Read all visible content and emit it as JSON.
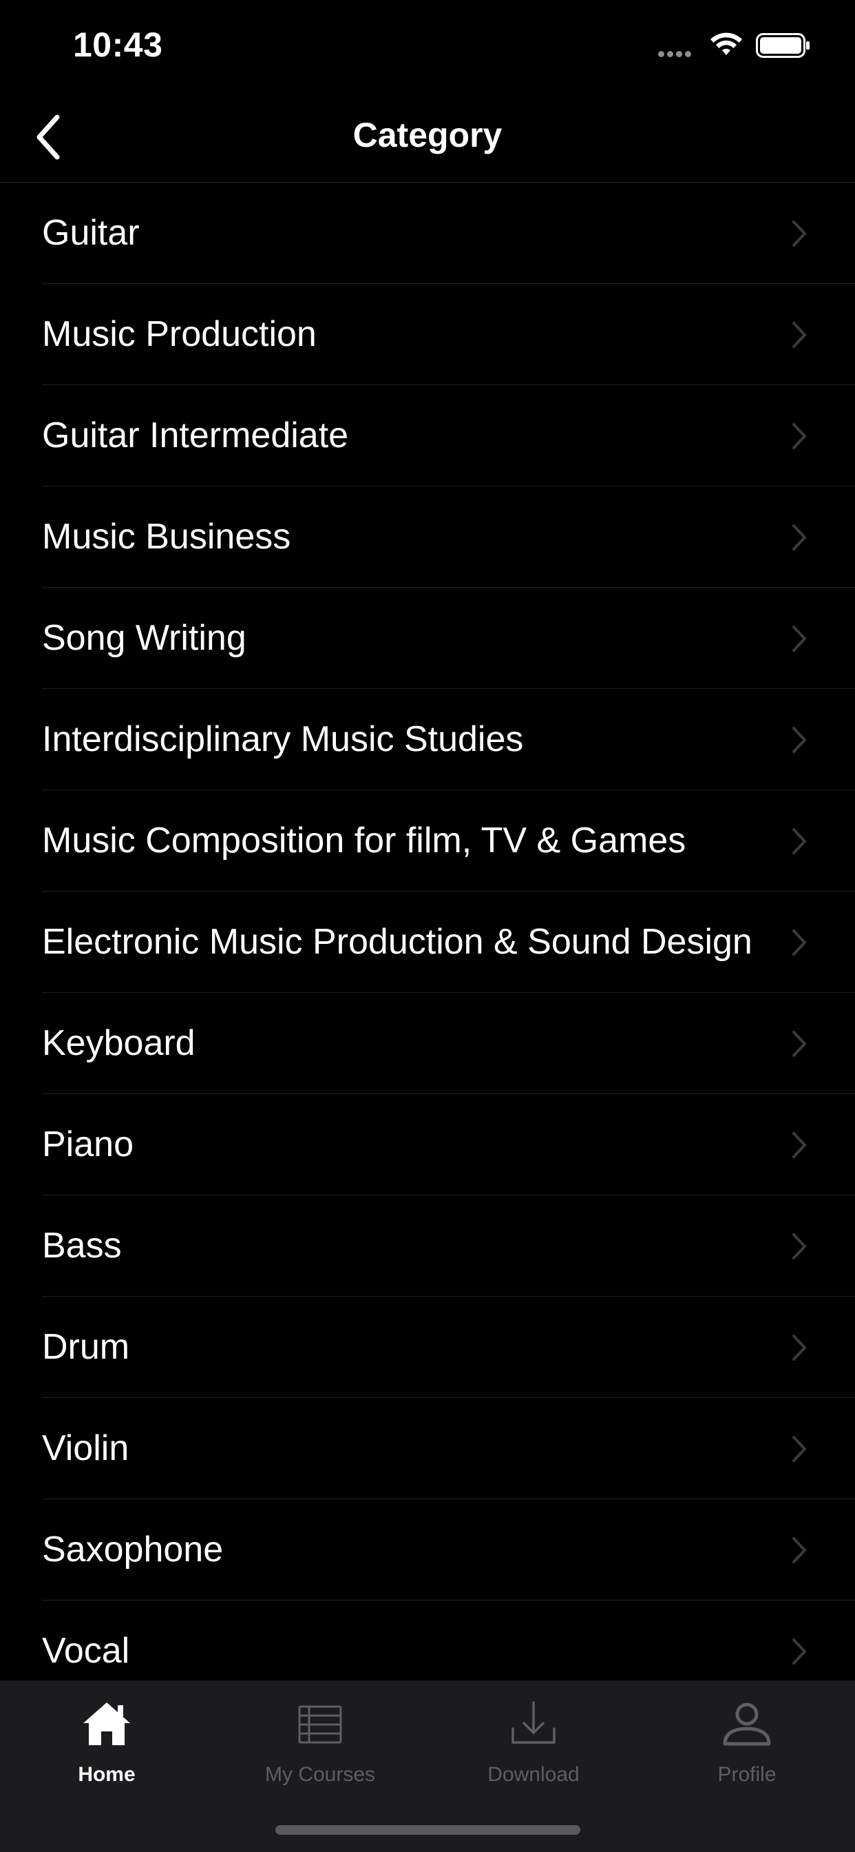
{
  "status_bar": {
    "time": "10:43"
  },
  "nav": {
    "title": "Category",
    "back_icon": "chevron-left-icon"
  },
  "categories": [
    {
      "label": "Guitar"
    },
    {
      "label": "Music Production"
    },
    {
      "label": "Guitar Intermediate"
    },
    {
      "label": "Music Business"
    },
    {
      "label": "Song Writing"
    },
    {
      "label": "Interdisciplinary Music Studies"
    },
    {
      "label": "Music Composition for film, TV & Games"
    },
    {
      "label": "Electronic Music Production & Sound Design"
    },
    {
      "label": "Keyboard"
    },
    {
      "label": "Piano"
    },
    {
      "label": "Bass"
    },
    {
      "label": "Drum"
    },
    {
      "label": "Violin"
    },
    {
      "label": "Saxophone"
    },
    {
      "label": "Vocal"
    }
  ],
  "tab_bar": {
    "tabs": [
      {
        "label": "Home",
        "icon": "home-icon",
        "active": true
      },
      {
        "label": "My Courses",
        "icon": "list-icon",
        "active": false
      },
      {
        "label": "Download",
        "icon": "download-icon",
        "active": false
      },
      {
        "label": "Profile",
        "icon": "profile-icon",
        "active": false
      }
    ]
  },
  "colors": {
    "background": "#000000",
    "text": "#ffffff",
    "chevron": "#3a3a3c",
    "separator": "#1f1f1f",
    "tab_bar_bg": "#1c1c1e",
    "tab_active": "#ffffff",
    "tab_inactive": "#5e5e63"
  }
}
